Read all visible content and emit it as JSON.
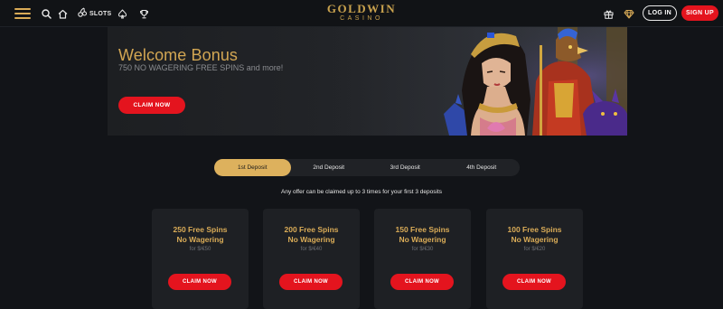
{
  "header": {
    "slots_label": "SLOTS",
    "logo_main": "GOLDWIN",
    "logo_sub": "CASINO",
    "login_label": "LOG IN",
    "signup_label": "SIGN UP"
  },
  "banner": {
    "title": "Welcome Bonus",
    "subtitle": "750 NO WAGERING FREE SPINS and more!",
    "cta_label": "CLAIM NOW"
  },
  "tabs": [
    {
      "label": "1st Deposit",
      "active": true
    },
    {
      "label": "2nd Deposit",
      "active": false
    },
    {
      "label": "3rd Deposit",
      "active": false
    },
    {
      "label": "4th Deposit",
      "active": false
    }
  ],
  "offer_note": "Any offer can be claimed up to 3 times for your first 3 deposits",
  "cards": [
    {
      "title": "250 Free Spins",
      "subtitle": "No Wagering",
      "price": "for $/€50",
      "cta_label": "CLAIM NOW"
    },
    {
      "title": "200 Free Spins",
      "subtitle": "No Wagering",
      "price": "for $/€40",
      "cta_label": "CLAIM NOW"
    },
    {
      "title": "150 Free Spins",
      "subtitle": "No Wagering",
      "price": "for $/€30",
      "cta_label": "CLAIM NOW"
    },
    {
      "title": "100 Free Spins",
      "subtitle": "No Wagering",
      "price": "for $/€20",
      "cta_label": "CLAIM NOW"
    }
  ],
  "colors": {
    "accent_gold": "#d9ab57",
    "cta_red": "#e4141e",
    "background": "#121418"
  }
}
